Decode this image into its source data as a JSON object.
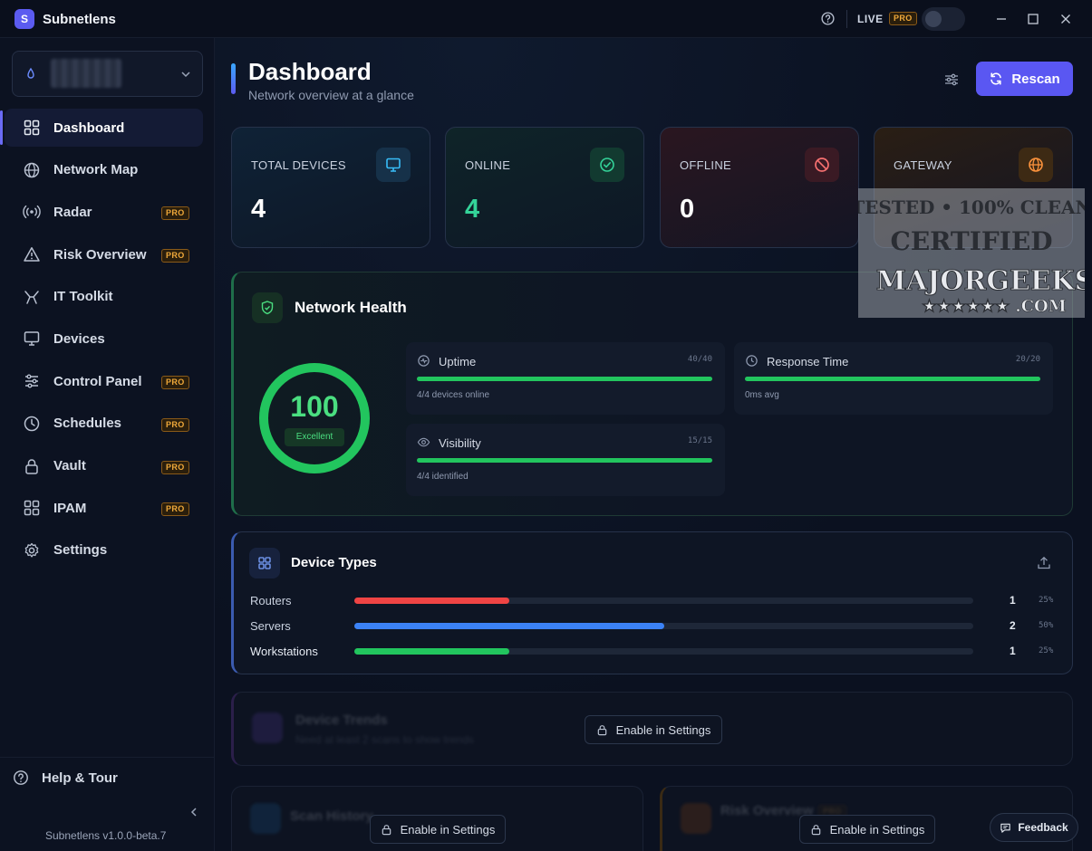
{
  "app": {
    "title": "Subnetlens",
    "logo_letter": "S"
  },
  "titlebar": {
    "live_label": "LIVE",
    "pro_label": "PRO"
  },
  "sidebar": {
    "items": [
      {
        "label": "Dashboard",
        "icon": "dashboard-grid-icon",
        "active": true
      },
      {
        "label": "Network Map",
        "icon": "globe-icon"
      },
      {
        "label": "Radar",
        "icon": "radar-icon",
        "pro": "PRO"
      },
      {
        "label": "Risk Overview",
        "icon": "warning-icon",
        "pro": "PRO"
      },
      {
        "label": "IT Toolkit",
        "icon": "toolkit-icon"
      },
      {
        "label": "Devices",
        "icon": "monitor-icon"
      },
      {
        "label": "Control Panel",
        "icon": "sliders-icon",
        "pro": "PRO"
      },
      {
        "label": "Schedules",
        "icon": "clock-icon",
        "pro": "PRO"
      },
      {
        "label": "Vault",
        "icon": "lock-icon",
        "pro": "PRO"
      },
      {
        "label": "IPAM",
        "icon": "ipam-grid-icon",
        "pro": "PRO"
      },
      {
        "label": "Settings",
        "icon": "gear-icon"
      }
    ],
    "help_label": "Help & Tour",
    "version": "Subnetlens v1.0.0-beta.7"
  },
  "header": {
    "title": "Dashboard",
    "subtitle": "Network overview at a glance",
    "rescan_label": "Rescan"
  },
  "stats": [
    {
      "label": "TOTAL DEVICES",
      "value": "4",
      "color": "#ffffff",
      "accent": "#38bdf8"
    },
    {
      "label": "ONLINE",
      "value": "4",
      "color": "#34d399",
      "accent": "#34d399"
    },
    {
      "label": "OFFLINE",
      "value": "0",
      "color": "#ffffff",
      "accent": "#f87171"
    },
    {
      "label": "GATEWAY",
      "value": "",
      "color": "#ffffff",
      "accent": "#fb923c"
    }
  ],
  "health": {
    "title": "Network Health",
    "score": "100",
    "score_fraction": 1.0,
    "grade": "Excellent",
    "metrics": [
      {
        "title": "Uptime",
        "score": "40/40",
        "sub": "4/4 devices online",
        "fraction": 1.0,
        "icon": "uptime-icon"
      },
      {
        "title": "Response Time",
        "score": "20/20",
        "sub": "0ms avg",
        "fraction": 1.0,
        "icon": "clock-icon"
      },
      {
        "title": "Visibility",
        "score": "15/15",
        "sub": "4/4 identified",
        "fraction": 1.0,
        "icon": "eye-icon"
      }
    ]
  },
  "device_types": {
    "title": "Device Types",
    "rows": [
      {
        "name": "Routers",
        "count": "1",
        "pct": "25%",
        "fraction": 0.25,
        "color": "#ef4444"
      },
      {
        "name": "Servers",
        "count": "2",
        "pct": "50%",
        "fraction": 0.5,
        "color": "#3b82f6"
      },
      {
        "name": "Workstations",
        "count": "1",
        "pct": "25%",
        "fraction": 0.25,
        "color": "#22c55e"
      }
    ]
  },
  "locked": {
    "trends_title": "Device Trends",
    "trends_sub": "Need at least 2 scans to show trends",
    "history_title": "Scan History",
    "risk_title": "Risk Overview",
    "risk_pro": "PRO",
    "enable_label": "Enable in Settings"
  },
  "feedback_label": "Feedback",
  "watermark": {
    "line1": "TESTED • 100% CLEAN",
    "line2": "CERTIFIED",
    "line3": "MAJORGEEKS",
    "line4": "★★★★★★ .COM"
  }
}
